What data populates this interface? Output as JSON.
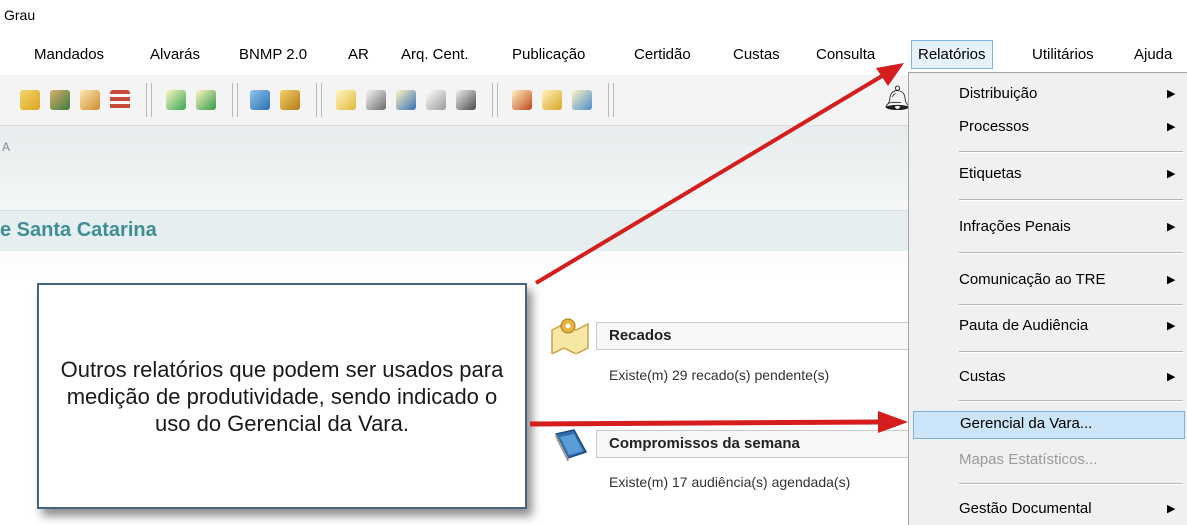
{
  "window": {
    "title": "Grau"
  },
  "menubar": {
    "items": [
      "Mandados",
      "Alvarás",
      "BNMP 2.0",
      "AR",
      "Arq. Cent.",
      "Publicação",
      "Certidão",
      "Custas",
      "Consulta",
      "Relatórios",
      "Utilitários",
      "Ajuda"
    ],
    "active": "Relatórios"
  },
  "toolbar": {
    "icons": [
      "search-doc-icon",
      "user-search-icon",
      "house-doc-icon",
      "table-icon",
      "doc-export-icon",
      "doc-forward-icon",
      "move-icon",
      "hierarchy-icon",
      "note-icon",
      "docs-icon",
      "doc-search-icon",
      "stamp-icon",
      "edit-doc-icon",
      "magnify-doc-icon",
      "doc-arrow-icon",
      "doc-up-icon",
      "bell-icon"
    ]
  },
  "page": {
    "partial_letter": "A",
    "banner_text": "e Santa Catarina"
  },
  "panels": {
    "recados": {
      "title": "Recados",
      "text": "Existe(m) 29 recado(s) pendente(s)"
    },
    "compromissos": {
      "title": "Compromissos da semana",
      "text": "Existe(m) 17 audiência(s) agendada(s)"
    }
  },
  "callout": {
    "text": "Outros relatórios que podem ser usados para medição de produtividade, sendo indicado o uso do Gerencial da Vara."
  },
  "dropdown": {
    "items": [
      {
        "label": "Distribuição",
        "submenu": "▶"
      },
      {
        "label": "Processos",
        "submenu": "▶"
      },
      {
        "label": "Etiquetas",
        "submenu": "▶"
      },
      {
        "label": "Infrações Penais",
        "submenu": "▶"
      },
      {
        "label": "Comunicação ao TRE",
        "submenu": "▶"
      },
      {
        "label": "Pauta de Audiência",
        "submenu": "▶"
      },
      {
        "label": "Custas",
        "submenu": "▶"
      },
      {
        "label": "Gerencial da Vara...",
        "submenu": ""
      },
      {
        "label": "Mapas Estatísticos...",
        "submenu": ""
      },
      {
        "label": "Gestão Documental",
        "submenu": "▶"
      }
    ]
  },
  "colors": {
    "annotation_red": "#d51d1d",
    "banner_text": "#3d8f93",
    "menu_highlight": "#cce4f7"
  }
}
